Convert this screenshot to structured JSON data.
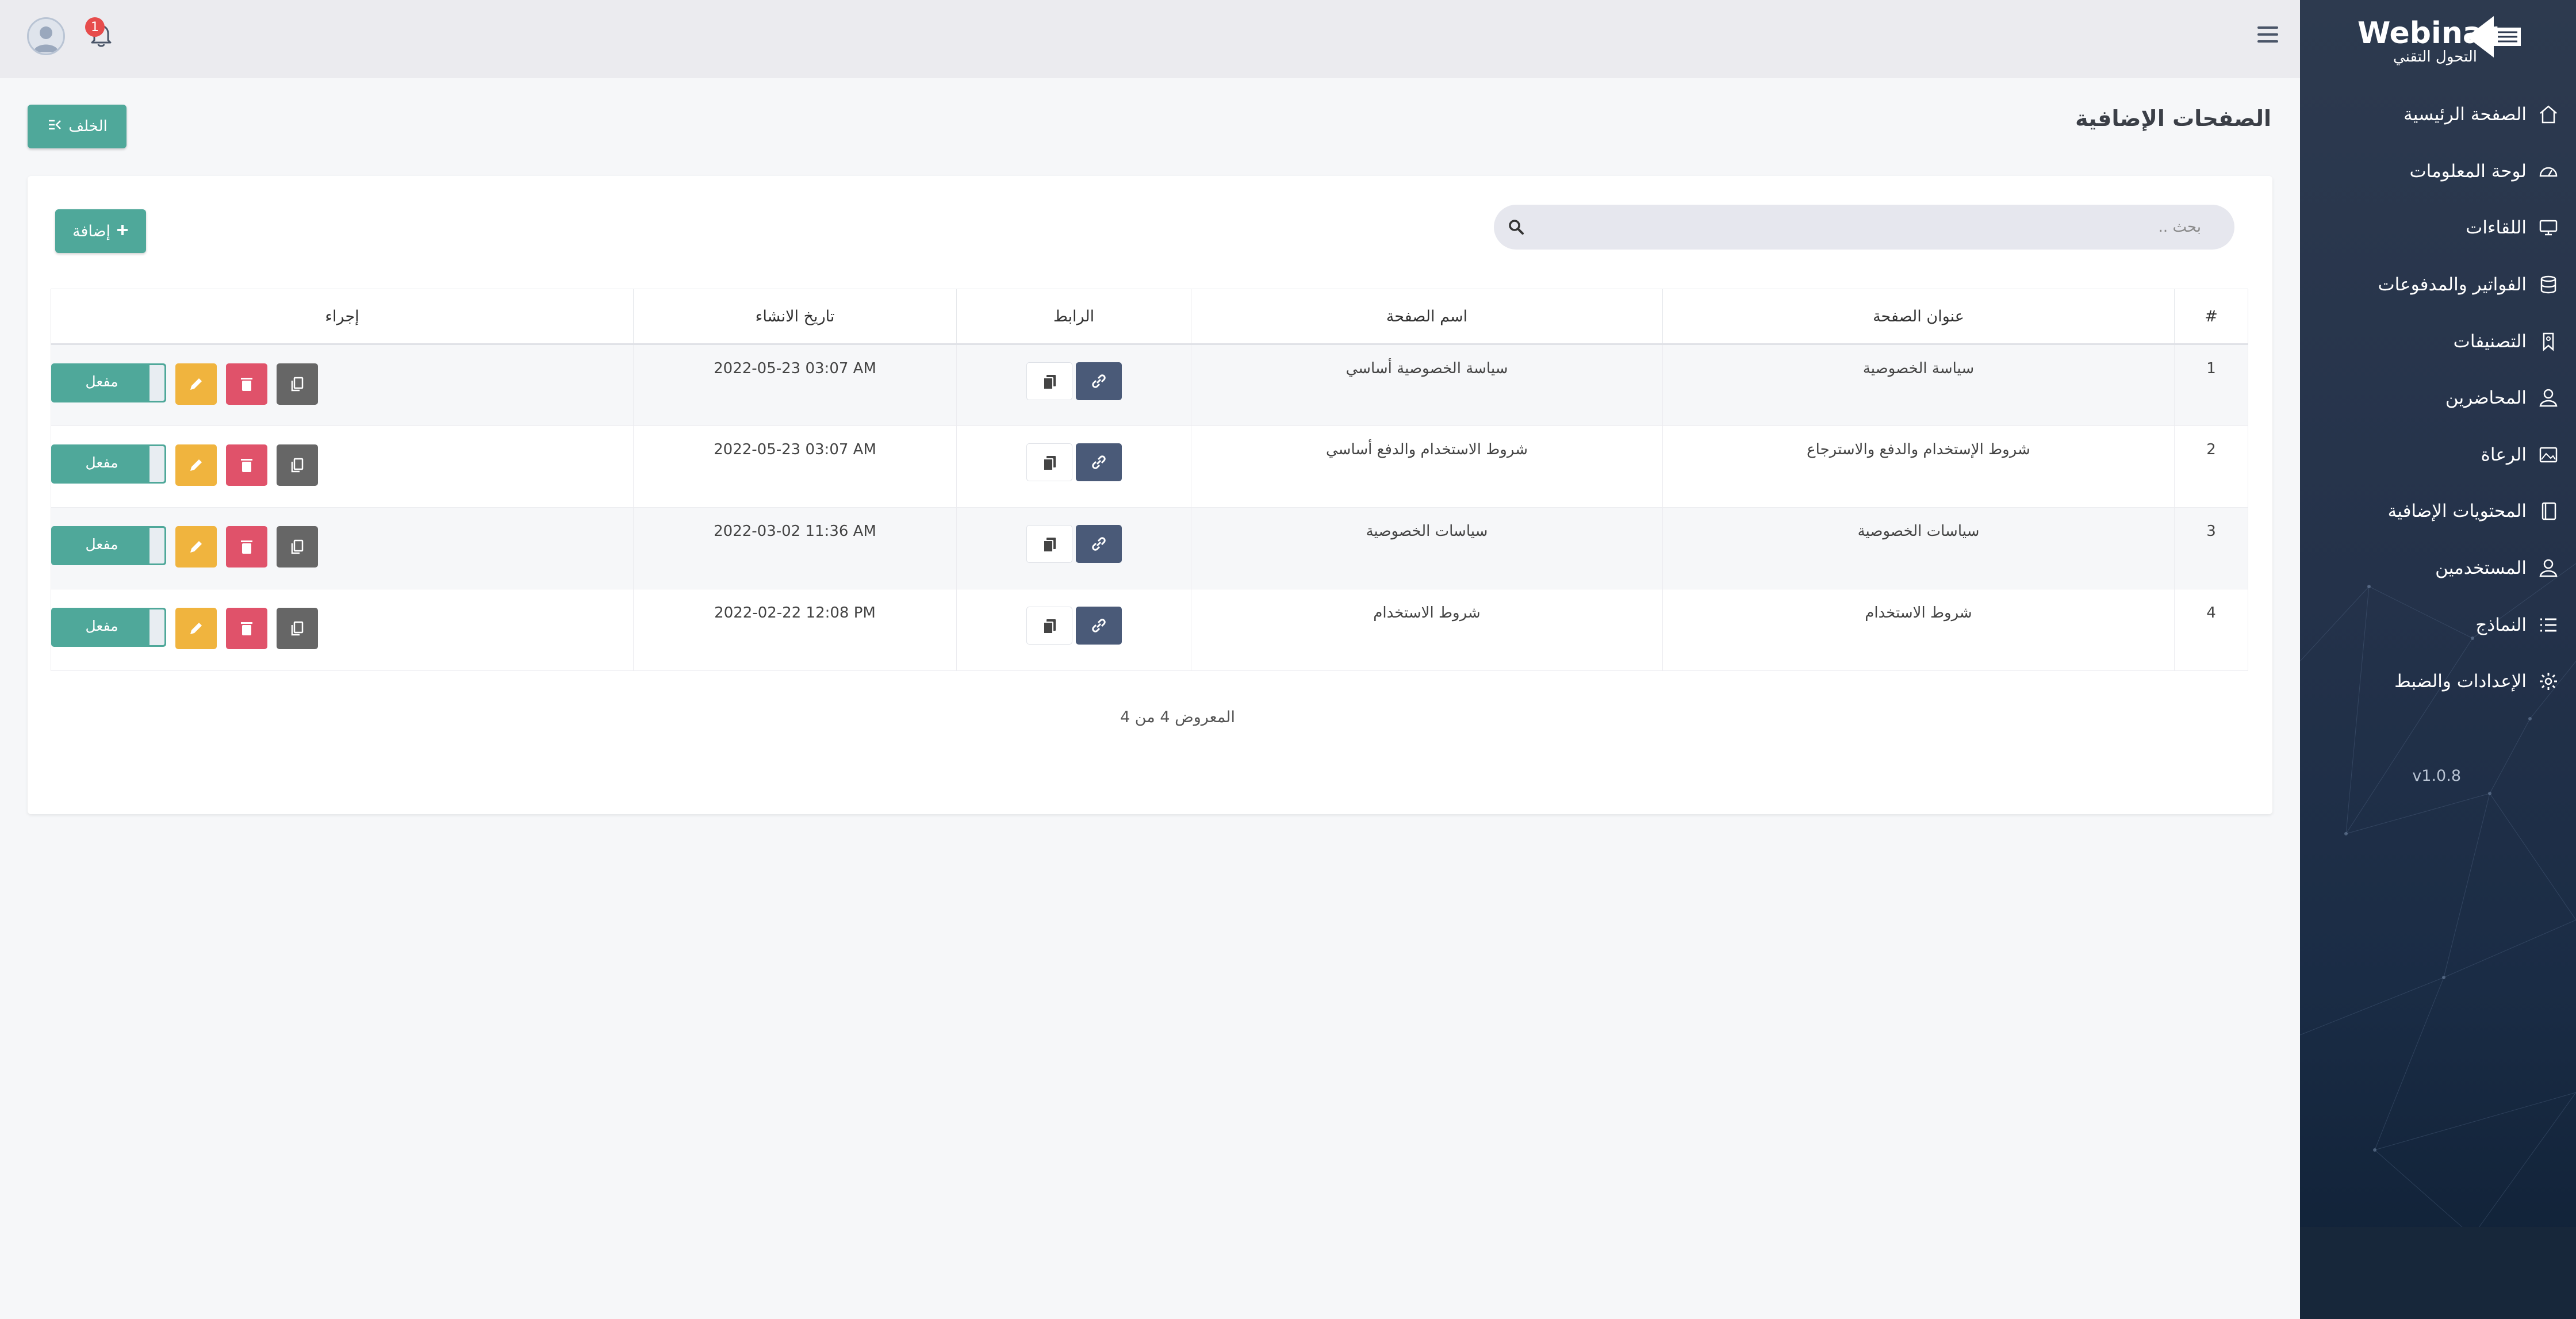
{
  "brand": {
    "name": "Webinar",
    "tagline": "التحول التقني"
  },
  "sidebar": {
    "items": [
      {
        "label": "الصفحة الرئيسية",
        "icon": "home-icon"
      },
      {
        "label": "لوحة المعلومات",
        "icon": "dashboard-icon"
      },
      {
        "label": "اللقاءات",
        "icon": "monitor-icon"
      },
      {
        "label": "الفواتير والمدفوعات",
        "icon": "database-icon"
      },
      {
        "label": "التصنيفات",
        "icon": "bookmark-icon"
      },
      {
        "label": "المحاضرين",
        "icon": "user-icon"
      },
      {
        "label": "الرعاة",
        "icon": "image-icon"
      },
      {
        "label": "المحتويات الإضافية",
        "icon": "book-icon"
      },
      {
        "label": "المستخدمين",
        "icon": "user-icon"
      },
      {
        "label": "النماذج",
        "icon": "list-icon"
      },
      {
        "label": "الإعدادات والضبط",
        "icon": "gear-icon"
      }
    ],
    "version": "v1.0.8"
  },
  "topbar": {
    "notifications_count": "1"
  },
  "page": {
    "title": "الصفحات الإضافية",
    "back_label": "الخلف"
  },
  "toolbar": {
    "search_placeholder": "بحث ..",
    "add_label": "إضافة"
  },
  "table": {
    "headers": {
      "num": "#",
      "title": "عنوان الصفحة",
      "name": "اسم الصفحة",
      "link": "الرابط",
      "date": "تاريخ الانشاء",
      "actions": "إجراء"
    },
    "rows": [
      {
        "num": "1",
        "title": "سياسة الخصوصية",
        "name": "سياسة الخصوصية أساسي",
        "date": "2022-05-23 03:07 AM",
        "status": "مفعل"
      },
      {
        "num": "2",
        "title": "شروط الإستخدام والدفع والاسترجاع",
        "name": "شروط الاستخدام والدفع أساسي",
        "date": "2022-05-23 03:07 AM",
        "status": "مفعل"
      },
      {
        "num": "3",
        "title": "سياسات الخصوصية",
        "name": "سياسات الخصوصية",
        "date": "2022-03-02 11:36 AM",
        "status": "مفعل"
      },
      {
        "num": "4",
        "title": "شروط الاستخدام",
        "name": "شروط الاستخدام",
        "date": "2022-02-22 12:08 PM",
        "status": "مفعل"
      }
    ]
  },
  "pagination": {
    "summary": "المعروض 4 من 4"
  },
  "colors": {
    "accent": "#4fa89a",
    "sidebar": "#24324a",
    "link_button": "#4a5a78",
    "edit": "#f0b43e",
    "delete": "#e0526a",
    "copy": "#666666"
  }
}
